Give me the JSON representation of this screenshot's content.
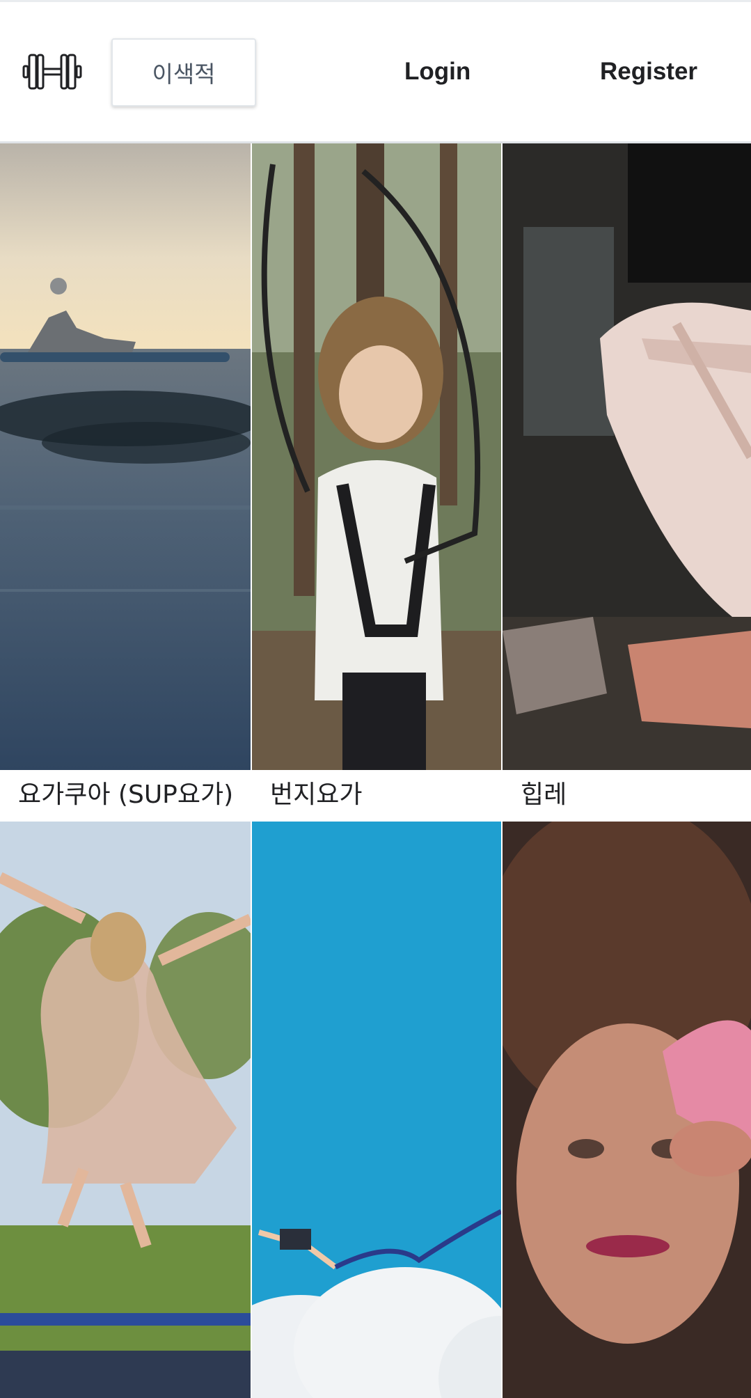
{
  "header": {
    "logo_icon": "dumbbell-icon",
    "search": {
      "value": "이색적",
      "placeholder": "이색적"
    },
    "login_label": "Login",
    "register_label": "Register"
  },
  "cards": [
    {
      "title": "요가쿠아 (SUP요가)",
      "image": "paddleboard-sunset-photo"
    },
    {
      "title": "번지요가",
      "image": "child-harness-swing-photo"
    },
    {
      "title": "힙레",
      "image": "ballet-pointe-shoe-photo"
    },
    {
      "title": "",
      "image": "girl-trampoline-photo"
    },
    {
      "title": "",
      "image": "bungee-jump-sky-photo"
    },
    {
      "title": "",
      "image": "smiling-girl-closeup-photo"
    }
  ],
  "colors": {
    "text": "#202124",
    "search_text": "#4a5563",
    "border": "#dfe3e7"
  }
}
